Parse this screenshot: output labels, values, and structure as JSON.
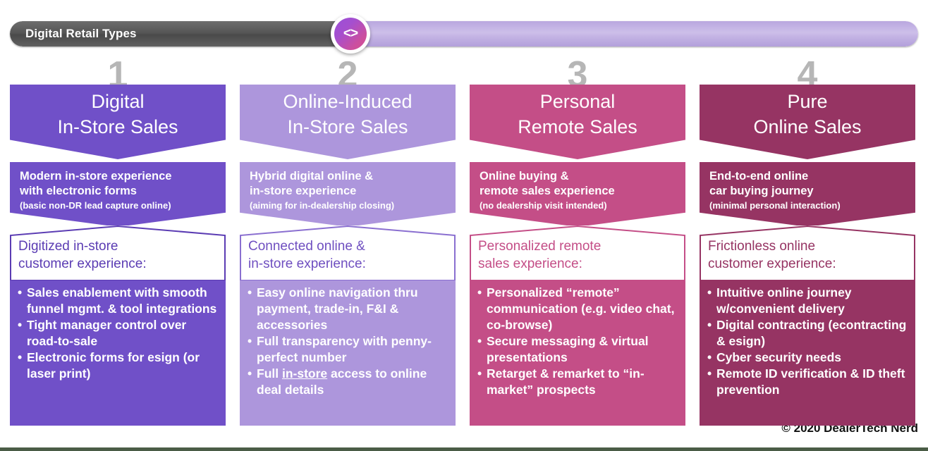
{
  "header": {
    "title": "Digital Retail  Types",
    "badge_icon": "code-brackets-icon",
    "badge_glyph": "<>",
    "dark_color": "#565656",
    "light_color": "#c4b4e4"
  },
  "footer": {
    "copyright": "© 2020 DealerTech Nerd"
  },
  "columns": [
    {
      "number": "1",
      "color": "#7050c8",
      "accent_text_color": "#5b3cb3",
      "title_line1": "Digital",
      "title_line2": "In-Store Sales",
      "desc_line1": "Modern in-store experience",
      "desc_line2": "with electronic forms",
      "desc_note": "(basic non-DR lead capture online)",
      "sub_line1": "Digitized in-store",
      "sub_line2": "customer experience:",
      "bullets": [
        "Sales enablement with smooth funnel mgmt. & tool integrations",
        "Tight manager control over road-to-sale",
        "Electronic forms for esign (or laser print)"
      ]
    },
    {
      "number": "2",
      "color": "#ad96dc",
      "accent_text_color": "#6f4fc0",
      "title_line1": "Online-Induced",
      "title_line2": "In-Store Sales",
      "desc_line1": "Hybrid digital online &",
      "desc_line2": "in-store experience",
      "desc_note": "(aiming for in-dealership closing)",
      "sub_line1": "Connected online &",
      "sub_line2": "in-store experience:",
      "bullets": [
        "Easy online navigation thru payment, trade-in, F&I & accessories",
        "Full transparency with penny-perfect number",
        "Full in-store access to online deal details"
      ],
      "bullet_underline": "in-store"
    },
    {
      "number": "3",
      "color": "#c44e87",
      "accent_text_color": "#c44e87",
      "title_line1": "Personal",
      "title_line2": "Remote Sales",
      "desc_line1": "Online buying &",
      "desc_line2": "remote sales experience",
      "desc_note": "(no dealership visit intended)",
      "sub_line1": "Personalized remote",
      "sub_line2": "sales experience:",
      "bullets": [
        "Personalized “remote” communication (e.g. video chat, co-browse)",
        "Secure messaging & virtual presentations",
        "Retarget & remarket to “in-market” prospects"
      ]
    },
    {
      "number": "4",
      "color": "#963463",
      "accent_text_color": "#963463",
      "title_line1": "Pure",
      "title_line2": "Online Sales",
      "desc_line1": "End-to-end online",
      "desc_line2": "car buying journey",
      "desc_note": "(minimal personal interaction)",
      "sub_line1": "Frictionless online",
      "sub_line2": "customer experience:",
      "bullets": [
        "Intuitive online journey w/convenient delivery",
        "Digital contracting (econtracting & esign)",
        "Cyber security needs",
        "Remote ID verification & ID theft prevention"
      ]
    }
  ]
}
